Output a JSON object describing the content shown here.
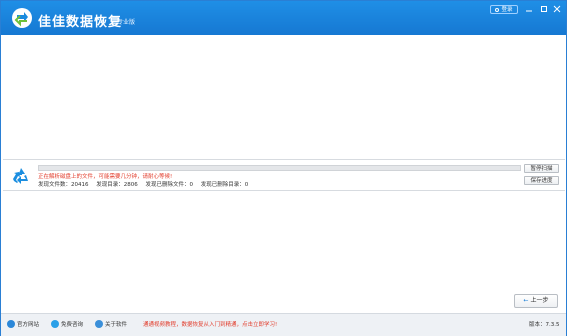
{
  "titlebar": {
    "app_title": "佳佳数据恢复",
    "edition": "专业版",
    "login_label": "登录"
  },
  "scan": {
    "progress": 0.0,
    "status_message": "正在解析磁盘上的文件，可能需要几分钟，请耐心等候!",
    "stats": {
      "files_found": "发现文件数：20416",
      "dirs_found": "发现目录：2806",
      "deleted_files_found": "发现已删除文件：0",
      "deleted_dirs_found": "发现已删除目录：0"
    },
    "pause_label": "暂停扫描",
    "save_label": "保存进度"
  },
  "nav": {
    "prev_label": "上一步"
  },
  "footer": {
    "official_site": "官方网站",
    "free_consult": "免费咨询",
    "about": "关于软件",
    "promo": "通通视频教程，数据恢复从入门到精通，点击立即学习!",
    "version": "版本：7.3.5"
  },
  "colors": {
    "titlebar": "#1678d2",
    "accent_red": "#e23b2a",
    "footer_bg": "#eef1f5"
  },
  "icons": {
    "logo": "app-logo-icon",
    "scan": "recycle-icon",
    "site": "globe-icon",
    "consult": "chat-icon",
    "about": "info-icon"
  }
}
